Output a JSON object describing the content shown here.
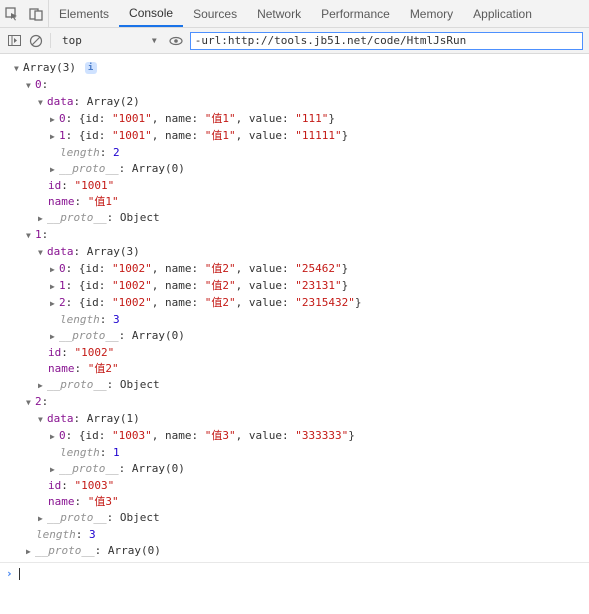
{
  "tabs": [
    "Elements",
    "Console",
    "Sources",
    "Network",
    "Performance",
    "Memory",
    "Application"
  ],
  "activeTab": "Console",
  "contextLabel": "top",
  "filterValue": "-url:http://tools.jb51.net/code/HtmlJsRun",
  "infoGlyph": "i",
  "rootLabel": "Array(3)",
  "protoArray": "Array(0)",
  "protoObject": "Object",
  "lengthLabel": "length",
  "protoLabel": "__proto__",
  "idKey": "id",
  "nameKey": "name",
  "valueKey": "value",
  "dataKey": "data",
  "rootLength": "3",
  "items": [
    {
      "key": "0",
      "dataLabel": "Array(2)",
      "rows": [
        {
          "idx": "0",
          "id": "1001",
          "name": "值1",
          "value": "111"
        },
        {
          "idx": "1",
          "id": "1001",
          "name": "值1",
          "value": "11111"
        }
      ],
      "length": "2",
      "id": "1001",
      "name": "值1"
    },
    {
      "key": "1",
      "dataLabel": "Array(3)",
      "rows": [
        {
          "idx": "0",
          "id": "1002",
          "name": "值2",
          "value": "25462"
        },
        {
          "idx": "1",
          "id": "1002",
          "name": "值2",
          "value": "23131"
        },
        {
          "idx": "2",
          "id": "1002",
          "name": "值2",
          "value": "2315432"
        }
      ],
      "length": "3",
      "id": "1002",
      "name": "值2"
    },
    {
      "key": "2",
      "dataLabel": "Array(1)",
      "rows": [
        {
          "idx": "0",
          "id": "1003",
          "name": "值3",
          "value": "333333"
        }
      ],
      "length": "1",
      "id": "1003",
      "name": "值3"
    }
  ]
}
